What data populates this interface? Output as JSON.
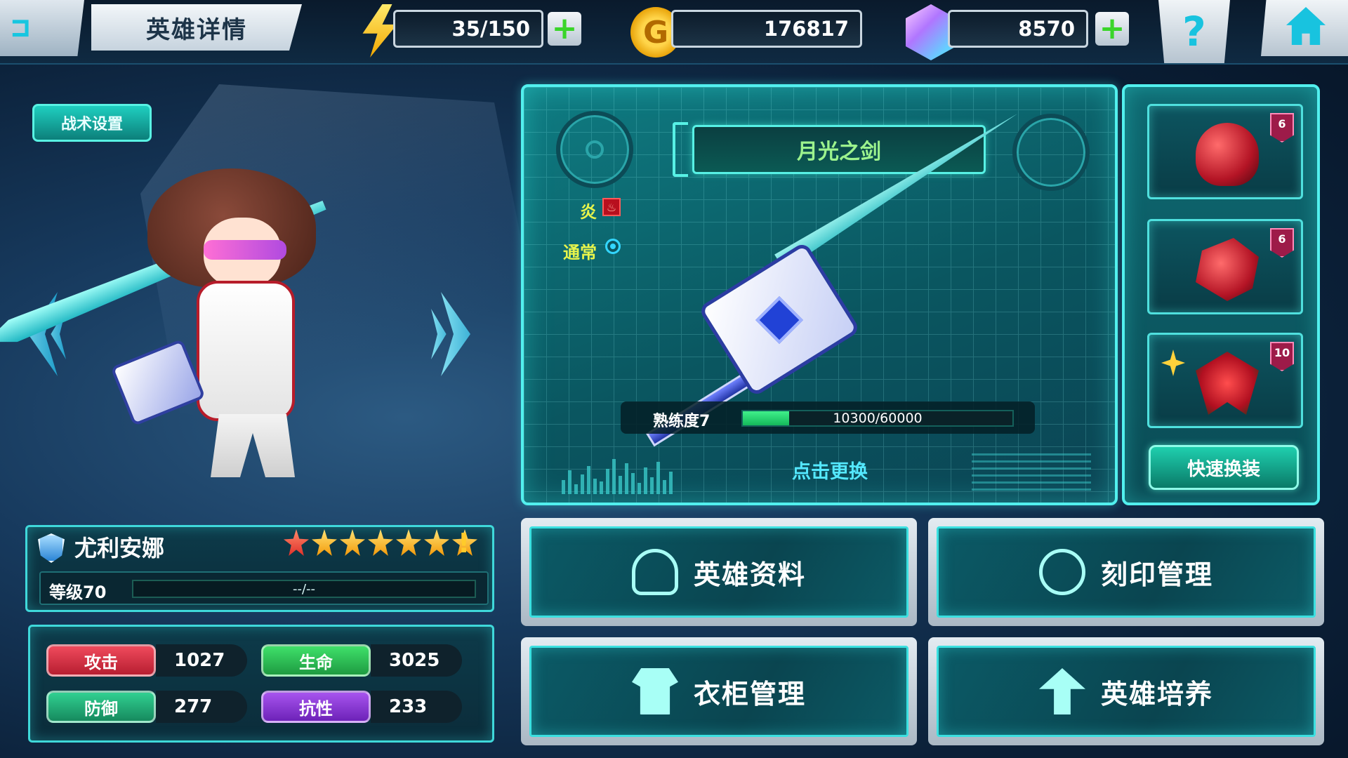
{
  "header": {
    "title": "英雄详情",
    "back_icon": "⊐",
    "energy": "35/150",
    "gold": "176817",
    "gold_symbol": "G",
    "gems": "8570",
    "plus_symbol": "+",
    "help_symbol": "?"
  },
  "left": {
    "tactics_button": "战术设置"
  },
  "hero": {
    "name": "尤利安娜",
    "stars": 7,
    "alert_symbol": "!",
    "level_label": "等级70",
    "exp_text": "--/--",
    "stats": {
      "attack_label": "攻击",
      "attack_value": "1027",
      "hp_label": "生命",
      "hp_value": "3025",
      "defense_label": "防御",
      "defense_value": "277",
      "resist_label": "抗性",
      "resist_value": "233"
    }
  },
  "weapon": {
    "name": "月光之剑",
    "element_label": "炎",
    "element_icon": "♨",
    "attack_type_label": "通常",
    "mastery_label": "熟练度7",
    "mastery_value": 10300,
    "mastery_max": 60000,
    "mastery_text": "10300/60000",
    "change_label": "点击更换"
  },
  "equipment": {
    "slots": [
      {
        "icon": "helmet-icon",
        "level": "6"
      },
      {
        "icon": "gauntlet-icon",
        "level": "6"
      },
      {
        "icon": "emblem-icon",
        "level": "10"
      }
    ],
    "quick_equip_label": "快速换装"
  },
  "menu": {
    "profile_label": "英雄资料",
    "imprint_label": "刻印管理",
    "wardrobe_label": "衣柜管理",
    "training_label": "英雄培养"
  },
  "colors": {
    "accent": "#52f0ee",
    "attack": "#d72f43",
    "hp": "#2dc657",
    "defense": "#21b37e",
    "resist": "#8e3ad6",
    "name_plate_text": "#9cf38d"
  }
}
